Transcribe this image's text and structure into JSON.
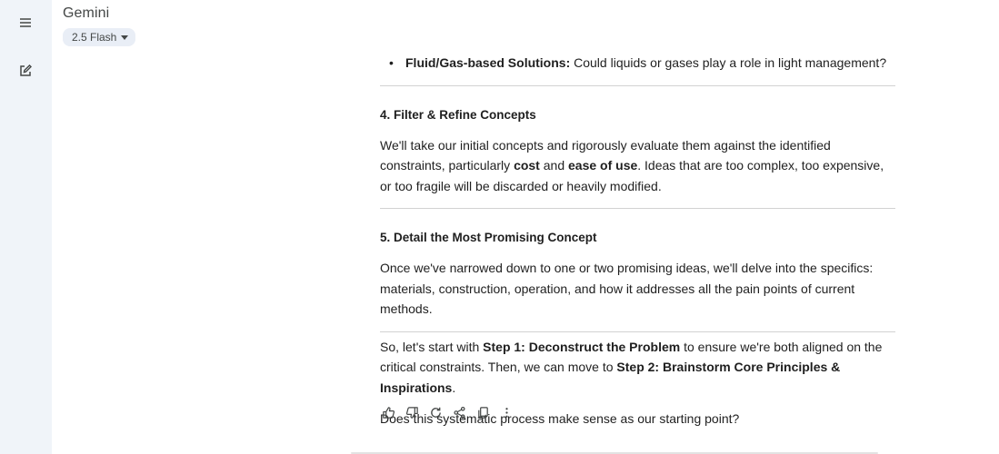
{
  "app": {
    "title": "Gemini",
    "model": "2.5 Flash"
  },
  "icons": {
    "menu": "menu-icon",
    "new_chat": "edit-icon",
    "model_caret": "caret-down-icon"
  },
  "message": {
    "bullet": {
      "bold": "Fluid/Gas-based Solutions:",
      "text": " Could liquids or gases play a role in light management?"
    },
    "step4": {
      "heading": "4. Filter & Refine Concepts",
      "p1": "We'll take our initial concepts and rigorously evaluate them against the identified constraints, particularly ",
      "b1": "cost",
      "p2": " and ",
      "b2": "ease of use",
      "p3": ". Ideas that are too complex, too expensive, or too fragile will be discarded or heavily modified."
    },
    "step5": {
      "heading": "5. Detail the Most Promising Concept",
      "text": "Once we've narrowed down to one or two promising ideas, we'll delve into the specifics: materials, construction, operation, and how it addresses all the pain points of current methods."
    },
    "closing": {
      "p1": "So, let's start with ",
      "b1": "Step 1: Deconstruct the Problem",
      "p2": " to ensure we're both aligned on the critical constraints. Then, we can move to ",
      "b2": "Step 2: Brainstorm Core Principles & Inspirations",
      "p3": "."
    },
    "question": "Does this systematic process make sense as our starting point?"
  },
  "actions": [
    "thumb-up-icon",
    "thumb-down-icon",
    "redo-icon",
    "share-icon",
    "copy-icon",
    "more-vert-icon"
  ]
}
